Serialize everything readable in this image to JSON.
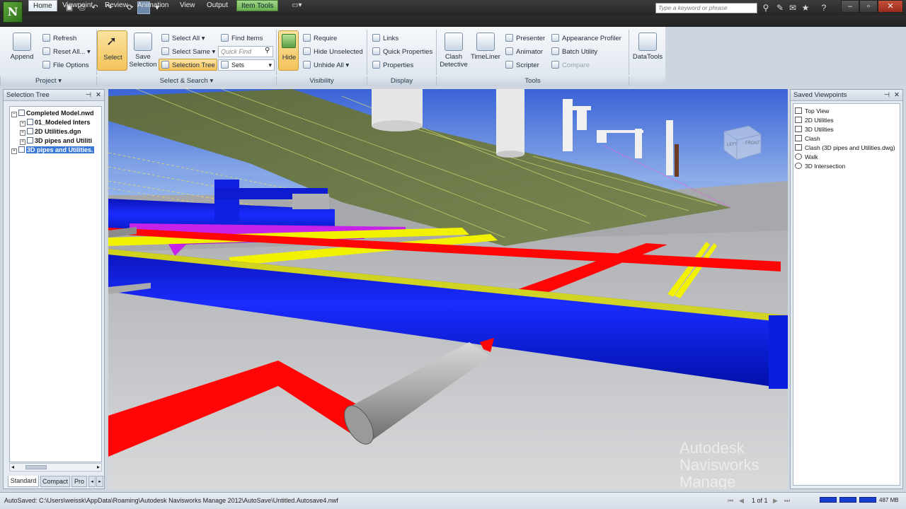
{
  "titlebar": {
    "logo": "N",
    "search_placeholder": "Type a keyword or phrase"
  },
  "tabs": [
    "Home",
    "Viewpoint",
    "Review",
    "Animation",
    "View",
    "Output",
    "Item Tools"
  ],
  "ribbon": {
    "project": {
      "append": "Append",
      "refresh": "Refresh",
      "reset_all": "Reset All...",
      "file_options": "File Options",
      "panel_label": "Project"
    },
    "select_search": {
      "select": "Select",
      "save_selection": "Save\nSelection",
      "select_all": "Select All",
      "select_same": "Select Same",
      "selection_tree": "Selection Tree",
      "find_items": "Find Items",
      "quick_find_placeholder": "Quick Find",
      "sets": "Sets",
      "panel_label": "Select & Search"
    },
    "visibility": {
      "hide": "Hide",
      "require": "Require",
      "hide_unselected": "Hide Unselected",
      "unhide_all": "Unhide All",
      "panel_label": "Visibility"
    },
    "display": {
      "links": "Links",
      "quick_properties": "Quick Properties",
      "properties": "Properties",
      "panel_label": "Display"
    },
    "tools": {
      "clash_detective": "Clash\nDetective",
      "timeliner": "TimeLiner",
      "presenter": "Presenter",
      "animator": "Animator",
      "scripter": "Scripter",
      "appearance_profiler": "Appearance Profiler",
      "batch_utility": "Batch Utility",
      "compare": "Compare",
      "panel_label": "Tools"
    },
    "datatools": {
      "label": "DataTools"
    }
  },
  "selection_tree": {
    "title": "Selection Tree",
    "items": [
      "Completed Model.nwd",
      "01_Modeled Inters",
      "2D Utilities.dgn",
      "3D pipes and Utiliti",
      "3D pipes and Utilities."
    ],
    "tabs": [
      "Standard",
      "Compact",
      "Pro"
    ]
  },
  "saved_viewpoints": {
    "title": "Saved Viewpoints",
    "items": [
      "Top View",
      "2D Utilities",
      "3D Utilities",
      "Clash",
      "Clash (3D pipes and Utilities.dwg)",
      "Walk",
      "3D Intersection"
    ]
  },
  "viewport": {
    "watermark_line1": "Autodesk",
    "watermark_line2": "Navisworks Manage",
    "viewcube_left": "LEFT",
    "viewcube_front": "FRONT"
  },
  "statusbar": {
    "autosave": "AutoSaved: C:\\Users\\weissk\\AppData\\Roaming\\Autodesk Navisworks Manage 2012\\AutoSave\\Untitled.Autosave4.nwf",
    "page": "1 of 1",
    "memory": "487 MB"
  },
  "colors": {
    "pipe_blue": "#0a1ee0",
    "pipe_red": "#ff0505",
    "pipe_magenta": "#c822e8",
    "pipe_yellow": "#f2f200",
    "surface_green": "#6c7a4a",
    "selection_highlight": "#f4c35a"
  }
}
